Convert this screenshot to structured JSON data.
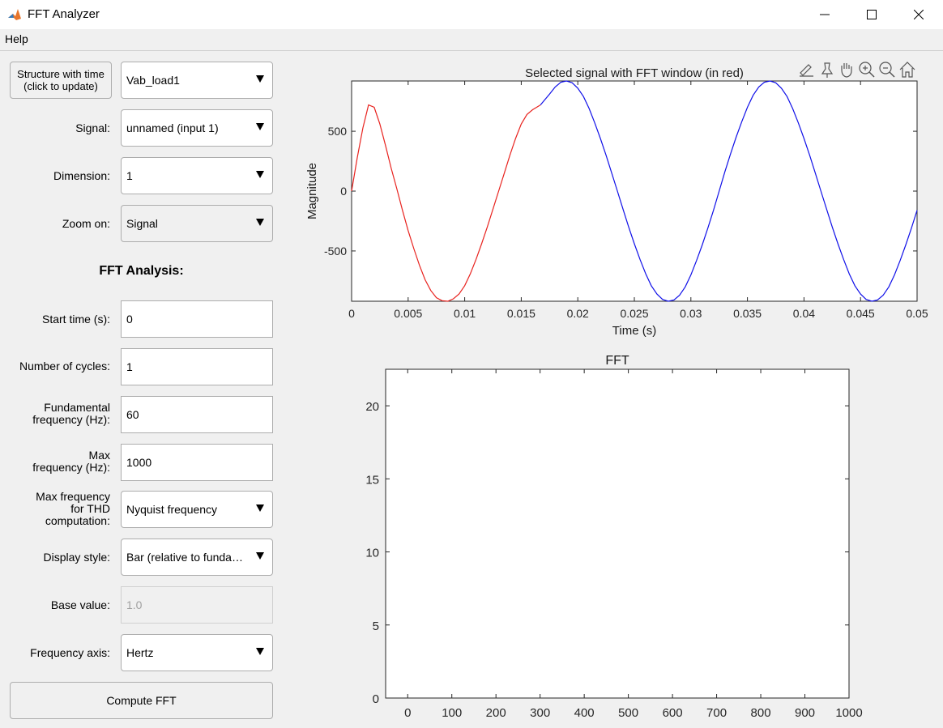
{
  "window": {
    "title": "FFT Analyzer"
  },
  "menu": {
    "help": "Help"
  },
  "panel": {
    "structure_button": [
      "Structure with time",
      "(click to update)"
    ],
    "structure_value": "Vab_load1",
    "signal_label": "Signal:",
    "signal_value": "unnamed (input 1)",
    "dimension_label": "Dimension:",
    "dimension_value": "1",
    "zoom_label": "Zoom on:",
    "zoom_value": "Signal",
    "fft_title": "FFT Analysis:",
    "start_time_label": "Start time (s):",
    "start_time_value": "0",
    "cycles_label": "Number of cycles:",
    "cycles_value": "1",
    "fund_label": [
      "Fundamental",
      "frequency (Hz):"
    ],
    "fund_value": "60",
    "maxfreq_label": [
      "Max",
      "frequency (Hz):"
    ],
    "maxfreq_value": "1000",
    "thd_label": [
      "Max frequency",
      "for THD",
      "computation:"
    ],
    "thd_value": "Nyquist frequency",
    "display_label": "Display style:",
    "display_value": "Bar (relative to funda…",
    "base_label": "Base value:",
    "base_value": "1.0",
    "freqaxis_label": "Frequency axis:",
    "freqaxis_value": "Hertz",
    "compute_button": "Compute FFT"
  },
  "chart_data": [
    {
      "type": "line",
      "title": "Selected signal with FFT window (in red)",
      "xlabel": "Time (s)",
      "ylabel": "Magnitude",
      "xlim": [
        0,
        0.05
      ],
      "ylim": [
        -920,
        920
      ],
      "xticks": [
        "0",
        "0.005",
        "0.01",
        "0.015",
        "0.02",
        "0.025",
        "0.03",
        "0.035",
        "0.04",
        "0.045",
        "0.05"
      ],
      "xtick_values": [
        0,
        0.005,
        0.01,
        0.015,
        0.02,
        0.025,
        0.03,
        0.035,
        0.04,
        0.045,
        0.05
      ],
      "yticks": [
        "-500",
        "0",
        "500"
      ],
      "ytick_values": [
        -500,
        0,
        500
      ],
      "series": [
        {
          "color": "#e8231f",
          "x": [
            0,
            0.0005,
            0.001,
            0.0015,
            0.002,
            0.0025,
            0.003,
            0.0035,
            0.004,
            0.0045,
            0.005,
            0.0055,
            0.006,
            0.0065,
            0.007,
            0.0075,
            0.008,
            0.0085,
            0.009,
            0.0095,
            0.01,
            0.0105,
            0.011,
            0.0115,
            0.012,
            0.0125,
            0.013,
            0.0135,
            0.014,
            0.0145,
            0.015,
            0.0155,
            0.016,
            0.0167
          ],
          "y": [
            0,
            280,
            530,
            720,
            700,
            560,
            380,
            190,
            20,
            -160,
            -330,
            -480,
            -620,
            -740,
            -830,
            -890,
            -915,
            -920,
            -900,
            -860,
            -790,
            -690,
            -570,
            -440,
            -300,
            -150,
            0,
            150,
            300,
            440,
            560,
            640,
            680,
            720
          ]
        },
        {
          "color": "#1010e8",
          "x": [
            0.0167,
            0.0175,
            0.018,
            0.0185,
            0.019,
            0.0195,
            0.02,
            0.0205,
            0.021,
            0.0215,
            0.022,
            0.0225,
            0.023,
            0.0235,
            0.024,
            0.0245,
            0.025,
            0.0255,
            0.026,
            0.0265,
            0.027,
            0.0275,
            0.028,
            0.0285,
            0.029,
            0.0295,
            0.03,
            0.0305,
            0.031,
            0.0315,
            0.032,
            0.0325,
            0.033,
            0.0335,
            0.034,
            0.0345,
            0.035,
            0.0355,
            0.036,
            0.0365,
            0.037,
            0.0375,
            0.038,
            0.0385,
            0.039,
            0.0395,
            0.04,
            0.0405,
            0.041,
            0.0415,
            0.042,
            0.0425,
            0.043,
            0.0435,
            0.044,
            0.0445,
            0.045,
            0.0455,
            0.046,
            0.0465,
            0.047,
            0.0475,
            0.048,
            0.0485,
            0.049,
            0.0495,
            0.05
          ],
          "y": [
            720,
            810,
            870,
            910,
            920,
            905,
            860,
            790,
            690,
            570,
            440,
            300,
            150,
            0,
            -150,
            -300,
            -440,
            -570,
            -690,
            -790,
            -860,
            -905,
            -920,
            -910,
            -870,
            -800,
            -700,
            -580,
            -450,
            -310,
            -160,
            0,
            160,
            310,
            450,
            580,
            700,
            800,
            870,
            910,
            920,
            905,
            860,
            790,
            690,
            570,
            440,
            300,
            150,
            0,
            -150,
            -300,
            -440,
            -570,
            -690,
            -790,
            -860,
            -905,
            -920,
            -910,
            -870,
            -800,
            -700,
            -580,
            -450,
            -310,
            -160
          ]
        }
      ]
    },
    {
      "type": "bar",
      "title": "FFT",
      "xlim": [
        -50,
        1000
      ],
      "ylim": [
        0,
        22.5
      ],
      "xticks": [
        "0",
        "100",
        "200",
        "300",
        "400",
        "500",
        "600",
        "700",
        "800",
        "900",
        "1000"
      ],
      "xtick_values": [
        0,
        100,
        200,
        300,
        400,
        500,
        600,
        700,
        800,
        900,
        1000
      ],
      "yticks": [
        "0",
        "5",
        "10",
        "15",
        "20"
      ],
      "ytick_values": [
        0,
        5,
        10,
        15,
        20
      ],
      "values": []
    }
  ],
  "toolbar_icons": [
    "brush-icon",
    "pin-icon",
    "pan-icon",
    "zoom-in-icon",
    "zoom-out-icon",
    "home-icon"
  ],
  "colors": {
    "signal_red": "#e8231f",
    "signal_blue": "#1010e8",
    "background": "#f0f0f0"
  }
}
